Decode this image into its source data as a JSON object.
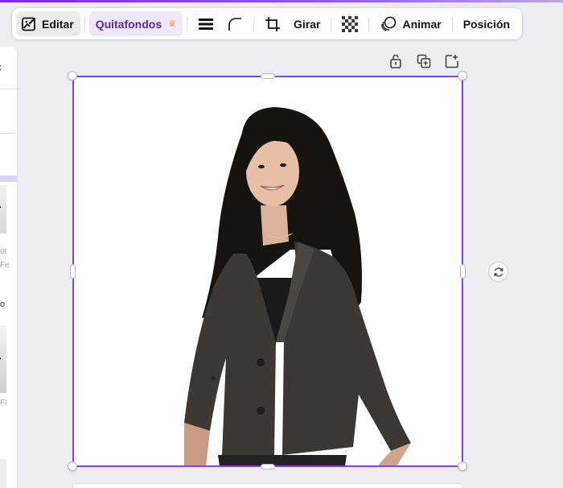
{
  "toolbar": {
    "edit_label": "Editar",
    "bg_remover_label": "Quitafondos",
    "rotate_label": "Girar",
    "animate_label": "Animar",
    "position_label": "Posición",
    "icons": {
      "edit": "image-edit-icon",
      "premium": "crown-icon",
      "border": "border-style-icon",
      "corner": "corner-rounding-icon",
      "crop": "crop-icon",
      "transparency": "transparency-checker-icon",
      "animate": "animate-icon"
    }
  },
  "element_actions": {
    "icons": [
      "lock-icon",
      "duplicate-icon",
      "add-page-icon"
    ]
  },
  "rotate_handle_icon": "rotate-icon",
  "colors": {
    "accent": "#8b3dff",
    "premium_bg": "#efe8fb",
    "premium_text": "#5b2bb5",
    "crown": "#f0a23a"
  },
  "side_panel": {
    "fragments": [
      "ot",
      "Fe",
      "o",
      "Fl"
    ]
  }
}
